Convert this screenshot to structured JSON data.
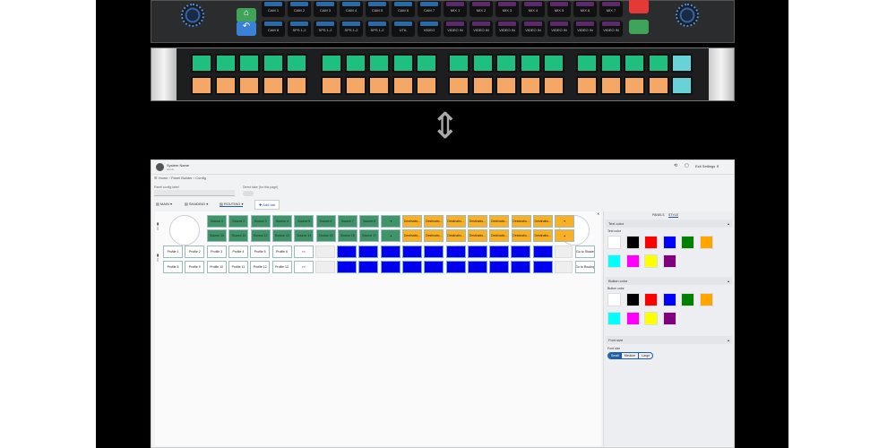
{
  "hardware": {
    "top_row_labels": [
      "CAM 1",
      "CAM 2",
      "CAM 3",
      "CAM 4",
      "CAM 5",
      "CAM 6",
      "CAM 7",
      "MIX 1",
      "MIX 2",
      "MIX 3",
      "MIX 4",
      "MIX 5",
      "MIX 6",
      "MIX 7"
    ],
    "bottom_row_labels": [
      "CAM 8",
      "SPS 1-2",
      "SPS 1-2",
      "SPS 1-2",
      "SPS 1-2",
      "UTIL",
      "VIDEO",
      "VIDEO IN",
      "VIDEO IN",
      "VIDEO IN",
      "VIDEO IN",
      "VIDEO IN",
      "VIDEO IN",
      "VIDEO IN"
    ],
    "colors": {
      "green": "#1fbf7f",
      "orange": "#f5a865",
      "cyan": "#67d3d8",
      "blue_tag": "#2b6aa8",
      "purple_tag": "#5a2a6a"
    }
  },
  "app": {
    "title": "System Name",
    "subtitle": "admin",
    "exit_label": "Exit Settings",
    "breadcrumb": [
      "Home",
      "Panel Builder",
      "Config"
    ],
    "config_label": "Panel config label",
    "direct_take_label": "Direct take (for this page)",
    "tabs": [
      "MAIN",
      "SHADING",
      "ROUTING"
    ],
    "active_tab": "ROUTING",
    "add_tab": "Add tab",
    "grid": {
      "row1": [
        "Source 1",
        "Source 2",
        "Source 3",
        "Source 4",
        "Source 5",
        "Source 6",
        "Source 7",
        "Source 8",
        "▾"
      ],
      "row2": [
        "Source 10",
        "Source 11",
        "Source 12",
        "Source 13",
        "Source 14",
        "Source 15",
        "Source 16",
        "Source 17",
        "▴"
      ],
      "dest": [
        "Destinatio...",
        "Destinatio...",
        "Destinatio...",
        "Destinatio...",
        "Destinatio...",
        "Destinatio...",
        "Destinatio...",
        "▾"
      ],
      "dest2": [
        "Destinatio...",
        "Destinatio...",
        "Destinatio...",
        "Destinatio...",
        "Destinatio...",
        "Destinatio...",
        "Destinatio...",
        "▴"
      ],
      "profiles1": [
        "Profile 1",
        "Profile 2",
        "Profile 3",
        "Profile 4",
        "Profile 5",
        "Profile 6",
        "<<"
      ],
      "profiles2": [
        "Profile 8",
        "Profile 9",
        "Profile 10",
        "Profile 11",
        "Profile 12",
        "Profile 13",
        ">>"
      ],
      "go_shade": "Go to Shade",
      "go_routing": "Go to Routing"
    },
    "panel_tabs": [
      "PANELS",
      "STYLE"
    ],
    "active_panel_tab": "STYLE",
    "text_color": {
      "section": "Text color",
      "label": "Text color"
    },
    "button_color": {
      "section": "Button color",
      "label": "Button color"
    },
    "font_size": {
      "section": "Font size",
      "label": "Font size",
      "options": [
        "Small",
        "Medium",
        "Large"
      ],
      "selected": "Small"
    },
    "swatches": [
      "#ffffff",
      "#000000",
      "#ff0000",
      "#0000ff",
      "#008000",
      "#ffa500",
      "#00ffff",
      "#ff00ff",
      "#ffff00",
      "#800080"
    ],
    "colors": {
      "green": "#3f9468",
      "orange": "#f9b025",
      "blue": "#0000ee"
    }
  }
}
